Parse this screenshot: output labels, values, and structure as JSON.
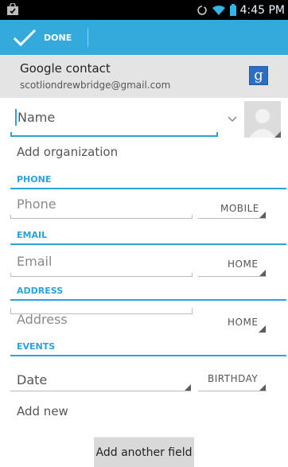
{
  "status_bar": {
    "time": "4:45 PM"
  },
  "action_bar": {
    "done_label": "DONE"
  },
  "account": {
    "title": "Google contact",
    "email": "scotliondrewbridge@gmail.com",
    "logo_glyph": "g"
  },
  "name_field": {
    "placeholder": "Name"
  },
  "organization": {
    "label": "Add organization"
  },
  "sections": {
    "phone": "PHONE",
    "email": "EMAIL",
    "address": "ADDRESS",
    "events": "EVENTS"
  },
  "phone_field": {
    "placeholder": "Phone",
    "type": "MOBILE"
  },
  "email_field": {
    "placeholder": "Email",
    "type": "HOME"
  },
  "address_field": {
    "placeholder": "Address",
    "type": "HOME"
  },
  "event_field": {
    "placeholder": "Date",
    "type": "BIRTHDAY"
  },
  "add_new": {
    "label": "Add new"
  },
  "add_another": {
    "label": "Add another field"
  },
  "colors": {
    "accent": "#34a9db",
    "section_blue": "#2aa3db",
    "account_bg": "#e4e4e4"
  }
}
